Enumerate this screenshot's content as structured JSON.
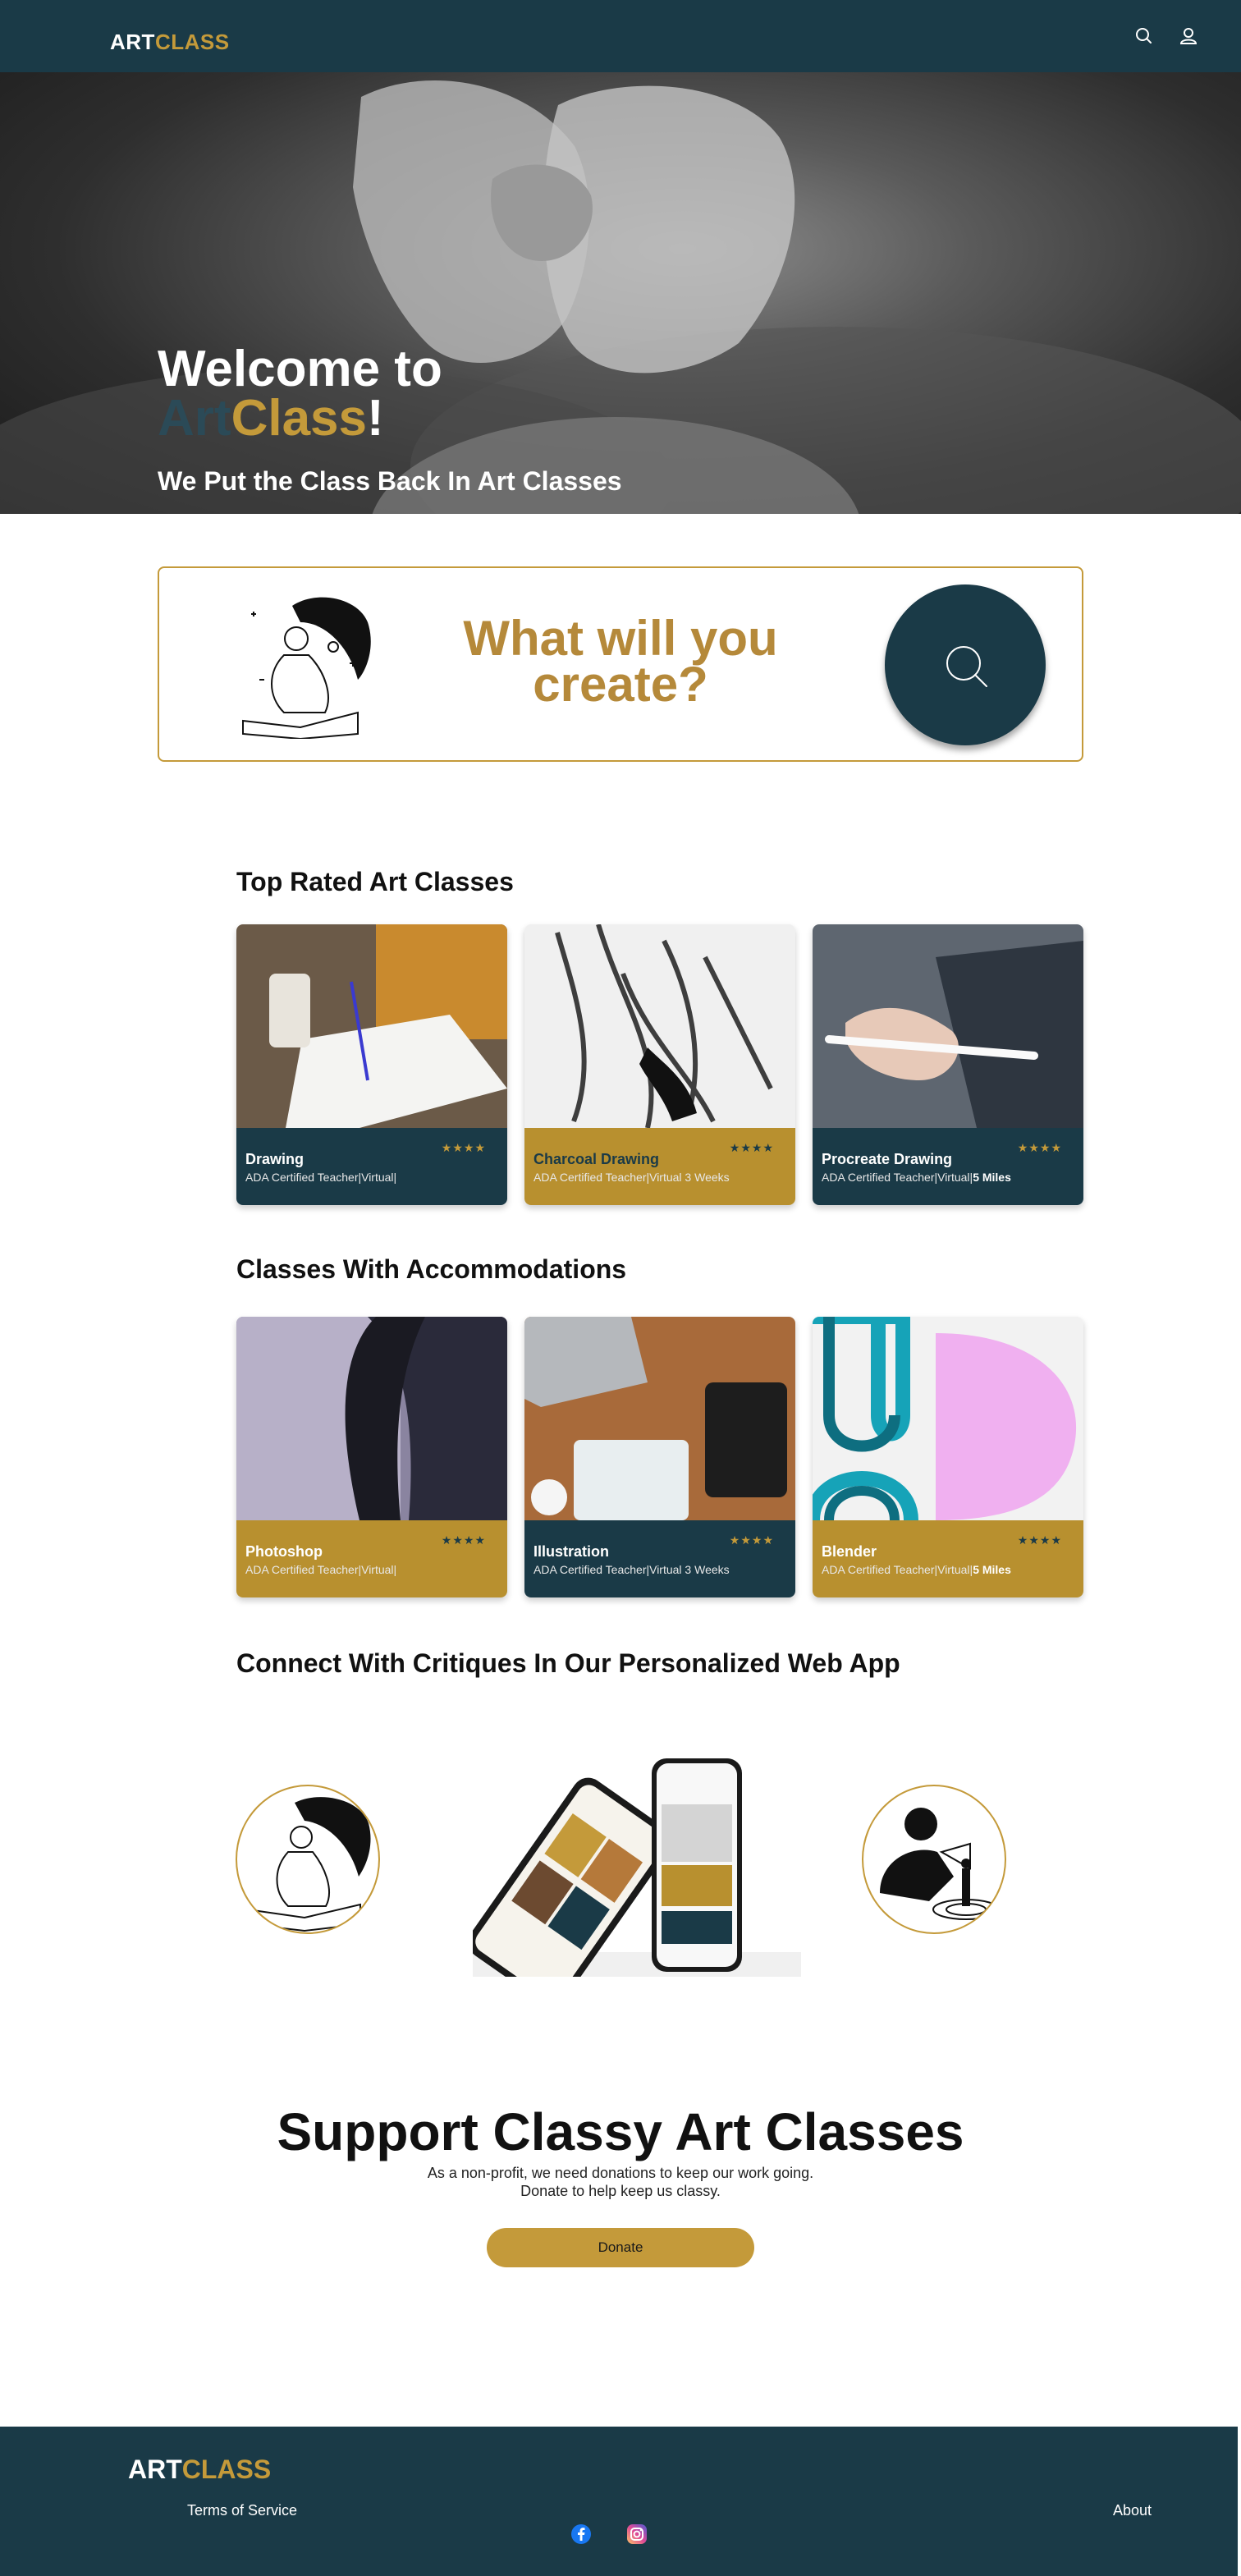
{
  "header": {
    "logo_part1": "ART",
    "logo_part2": "CLASS",
    "icons": [
      "search-icon",
      "user-icon"
    ]
  },
  "hero": {
    "title_line1": "Welcome to",
    "title_art": "Art",
    "title_class": "Class",
    "title_exclaim": "!",
    "subtitle": "We Put the Class Back In Art Classes"
  },
  "search": {
    "prompt_line1": "What will you",
    "prompt_line2": "create?",
    "icon": "search-icon"
  },
  "top_rated": {
    "title": "Top Rated Art Classes",
    "cards": [
      {
        "title": "Drawing",
        "stars": "★★★★",
        "subtitle": "ADA Certified Teacher|Virtual|",
        "extra": ""
      },
      {
        "title": "Charcoal Drawing",
        "stars": "★★★★",
        "subtitle": "ADA Certified Teacher|Virtual   3 Weeks",
        "extra": ""
      },
      {
        "title": "Procreate Drawing",
        "stars": "★★★★",
        "subtitle": "ADA Certified Teacher|Virtual|",
        "extra": "5 Miles"
      }
    ]
  },
  "accommodations": {
    "title": "Classes With Accommodations",
    "cards": [
      {
        "title": "Photoshop",
        "stars": "★★★★",
        "subtitle": "ADA Certified Teacher|Virtual|",
        "extra": ""
      },
      {
        "title": "Illustration",
        "stars": "★★★★",
        "subtitle": "ADA Certified Teacher|Virtual   3 Weeks",
        "extra": ""
      },
      {
        "title": "Blender",
        "stars": "★★★★",
        "subtitle": "ADA Certified Teacher|Virtual|",
        "extra": "5 Miles"
      }
    ]
  },
  "connect": {
    "title": "Connect With Critiques In Our Personalized Web App"
  },
  "support": {
    "title": "Support Classy Art Classes",
    "text": "As a non-profit, we need donations to keep our work going. Donate to help keep us classy.",
    "button": "Donate"
  },
  "footer": {
    "logo_part1": "ART",
    "logo_part2": "CLASS",
    "terms": "Terms of Service",
    "about": "About",
    "social_icons": [
      "facebook-icon",
      "instagram-icon"
    ]
  },
  "colors": {
    "navy": "#1a3a47",
    "gold": "#c49a3a"
  }
}
